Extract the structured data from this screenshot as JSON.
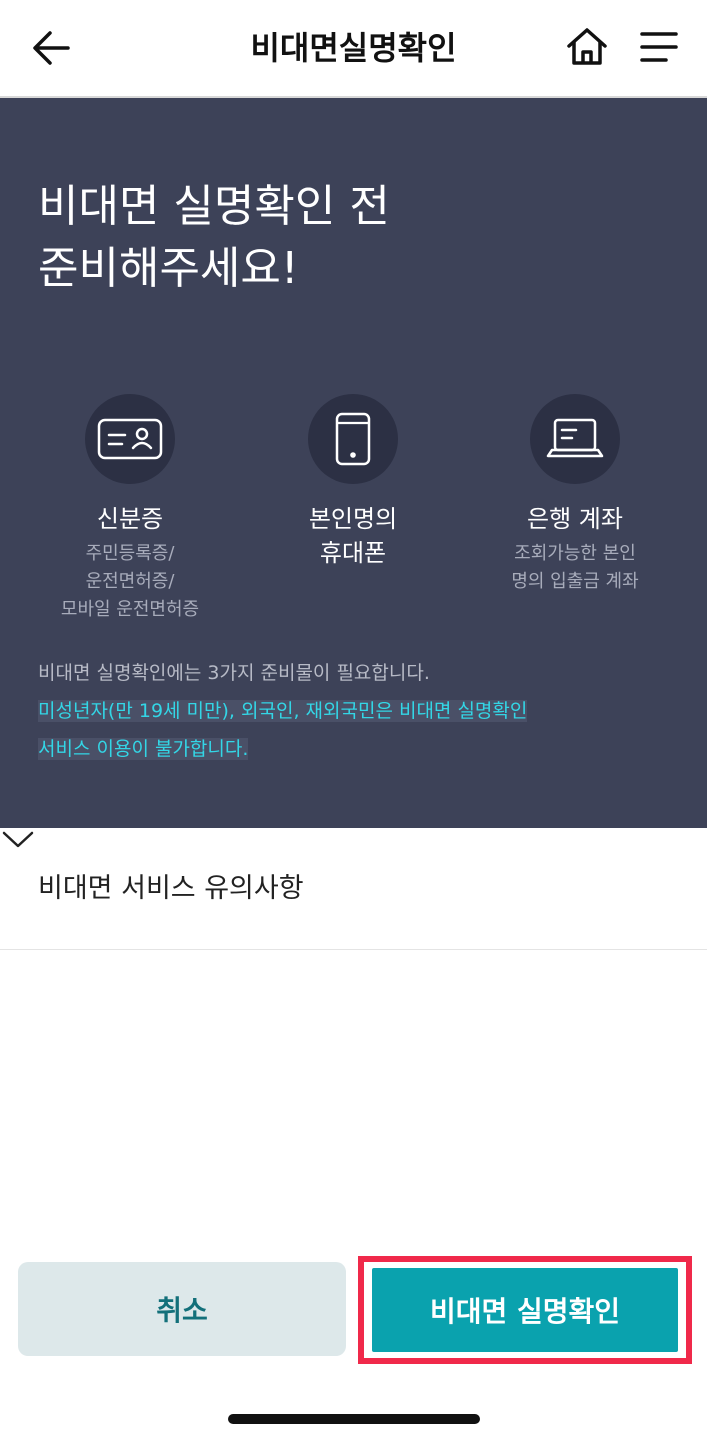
{
  "header": {
    "title": "비대면실명확인",
    "back_icon": "arrow-left-icon",
    "home_icon": "home-icon",
    "menu_icon": "hamburger-menu-icon"
  },
  "hero": {
    "headline_line1": "비대면 실명확인 전",
    "headline_line2": "준비해주세요!",
    "requirements": [
      {
        "icon": "id-card-icon",
        "name": "신분증",
        "desc": [
          "주민등록증/",
          "운전면허증/",
          "모바일 운전면허증"
        ]
      },
      {
        "icon": "smartphone-icon",
        "name_lines": [
          "본인명의",
          "휴대폰"
        ]
      },
      {
        "icon": "laptop-icon",
        "name": "은행 계좌",
        "desc": [
          "조회가능한 본인",
          "명의 입출금 계좌"
        ]
      }
    ],
    "notice_plain": "비대면 실명확인에는 3가지 준비물이 필요합니다.",
    "notice_highlight_line1": "미성년자(만 19세 미만), 외국인, 재외국민은 비대면 실명확인",
    "notice_highlight_line2": "서비스 이용이 불가합니다."
  },
  "accordion": {
    "label": "비대면 서비스 유의사항",
    "icon": "chevron-down-icon"
  },
  "buttons": {
    "cancel_label": "취소",
    "confirm_label": "비대면 실명확인"
  },
  "colors": {
    "hero_bg": "#3d4258",
    "accent": "#0aa2ae",
    "highlight_text": "#33d6e6",
    "emphasis_frame": "#f0294a"
  }
}
